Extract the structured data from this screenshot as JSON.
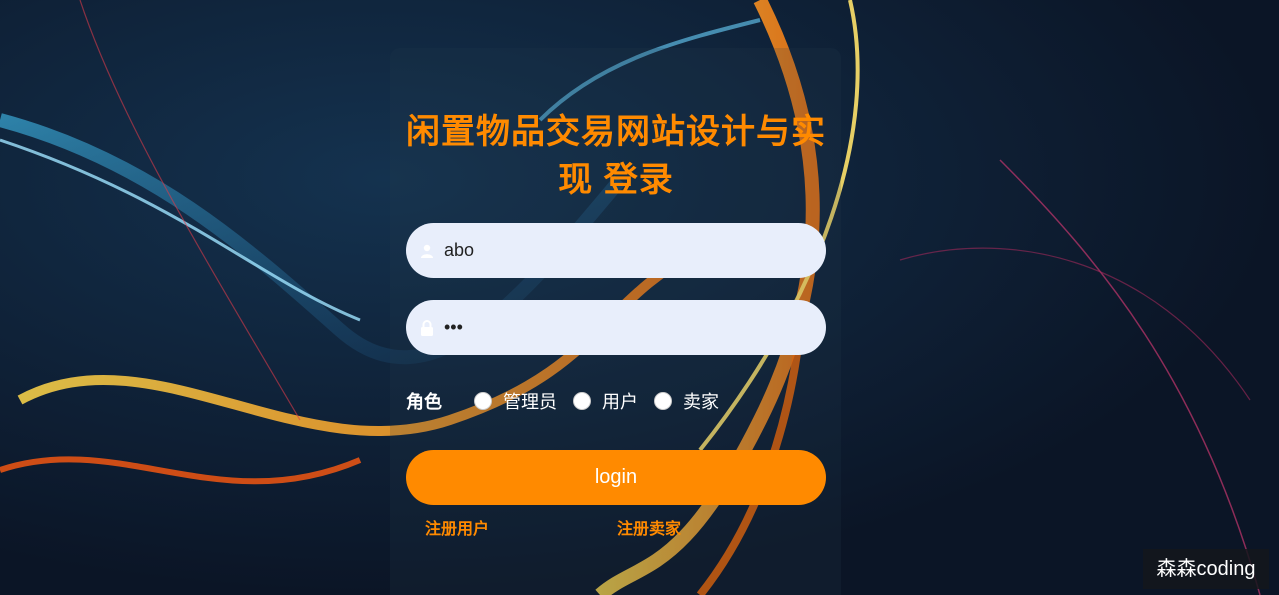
{
  "title": "闲置物品交易网站设计与实现 登录",
  "username": {
    "value": "abo",
    "icon": "user-icon"
  },
  "password": {
    "value": "abc",
    "icon": "lock-icon"
  },
  "role": {
    "label": "角色",
    "options": [
      "管理员",
      "用户",
      "卖家"
    ]
  },
  "login_label": "login",
  "links": {
    "register_user": "注册用户",
    "register_seller": "注册卖家"
  },
  "watermark": "森森coding",
  "colors": {
    "accent": "#ff8a00",
    "input_bg": "#e8eefb",
    "background": "#0b1526"
  }
}
